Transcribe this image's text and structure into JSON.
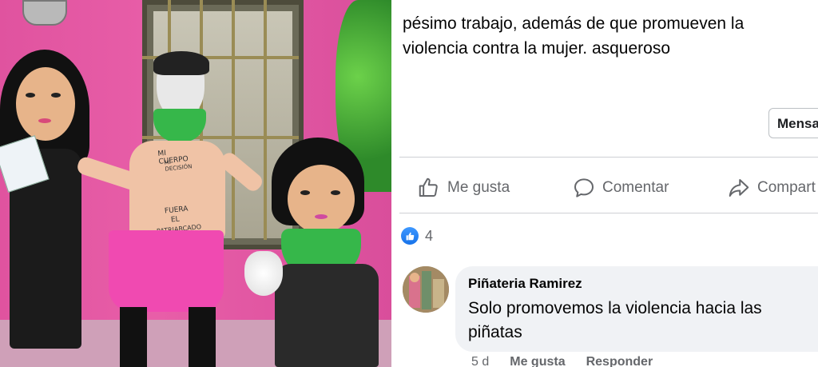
{
  "post": {
    "text_lines": [
      "pésimo trabajo, además de que promueven la",
      "violencia contra la mujer. asqueroso"
    ],
    "message_button": "Mensa"
  },
  "actions": {
    "like": "Me gusta",
    "comment": "Comentar",
    "share": "Compart"
  },
  "reactions": {
    "count": "4"
  },
  "comment": {
    "author": "Piñateria Ramirez",
    "text_lines": [
      "Solo promovemos la violencia hacia las",
      "piñatas"
    ],
    "meta": {
      "time": "5 d",
      "like": "Me gusta",
      "reply": "Responder"
    }
  },
  "photo": {
    "torso_writing": [
      "MI CUERPO",
      "MI DECISIÓN",
      "FUERA",
      "EL",
      "PATRIARCADO"
    ]
  },
  "colors": {
    "facebook_blue": "#1877f2",
    "secondary_text": "#65676b",
    "bubble_bg": "#f0f2f5",
    "wall_pink": "#e0539f",
    "bandana_green": "#36b74a"
  }
}
